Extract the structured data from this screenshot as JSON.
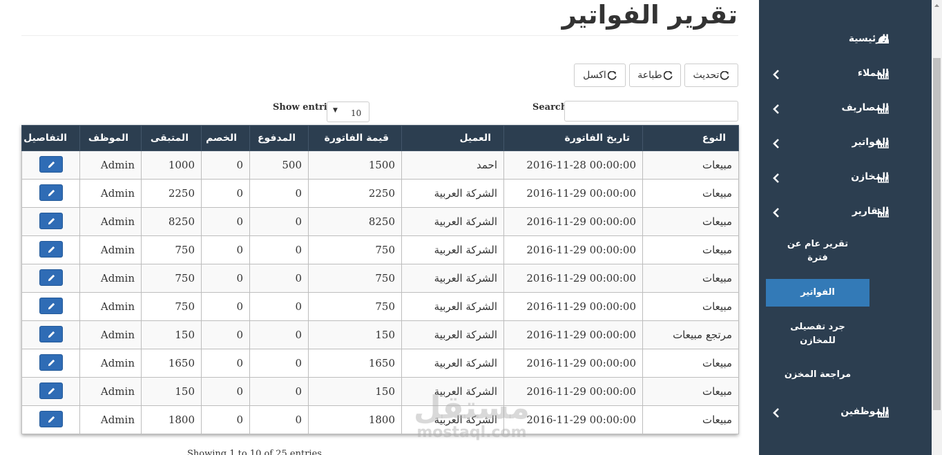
{
  "page": {
    "title": "تقرير الفواتير"
  },
  "toolbar": {
    "refresh_label": "تحديث",
    "print_label": "طباعة",
    "excel_label": "اكسل"
  },
  "controls": {
    "search_label": "Search:",
    "show_entries_label": "Show entries",
    "entries_value": "10"
  },
  "table": {
    "headers": [
      "النوع",
      "تاريخ الفاتورة",
      "العميل",
      "قيمة الفاتورة",
      "المدفوع",
      "الخصم",
      "المتبقى",
      "الموظف",
      "التفاصيل"
    ],
    "rows": [
      [
        "مبيعات",
        "2016-11-28 00:00:00",
        "احمد",
        "1500",
        "500",
        "0",
        "1000",
        "Admin"
      ],
      [
        "مبيعات",
        "2016-11-29 00:00:00",
        "الشركة العربية",
        "2250",
        "0",
        "0",
        "2250",
        "Admin"
      ],
      [
        "مبيعات",
        "2016-11-29 00:00:00",
        "الشركة العربية",
        "8250",
        "0",
        "0",
        "8250",
        "Admin"
      ],
      [
        "مبيعات",
        "2016-11-29 00:00:00",
        "الشركة العربية",
        "750",
        "0",
        "0",
        "750",
        "Admin"
      ],
      [
        "مبيعات",
        "2016-11-29 00:00:00",
        "الشركة العربية",
        "750",
        "0",
        "0",
        "750",
        "Admin"
      ],
      [
        "مبيعات",
        "2016-11-29 00:00:00",
        "الشركة العربية",
        "750",
        "0",
        "0",
        "750",
        "Admin"
      ],
      [
        "مرتجع مبيعات",
        "2016-11-29 00:00:00",
        "الشركة العربية",
        "150",
        "0",
        "0",
        "150",
        "Admin"
      ],
      [
        "مبيعات",
        "2016-11-29 00:00:00",
        "الشركة العربية",
        "1650",
        "0",
        "0",
        "1650",
        "Admin"
      ],
      [
        "مبيعات",
        "2016-11-29 00:00:00",
        "الشركة العربية",
        "150",
        "0",
        "0",
        "150",
        "Admin"
      ],
      [
        "مبيعات",
        "2016-11-29 00:00:00",
        "الشركة العربية",
        "1800",
        "0",
        "0",
        "1800",
        "Admin"
      ]
    ],
    "info": "Showing 1 to 10 of 25 entries"
  },
  "sidebar": {
    "home_label": "الرئيسية",
    "customers_label": "العملاء",
    "expenses_label": "المصاريف",
    "invoices_label": "الفواتير",
    "stores_label": "المخازن",
    "reports_label": "التقارير",
    "sub_period_report": "تقرير عام عن فترة",
    "sub_invoices": "الفواتير",
    "sub_inventory": "جرد تفصيلى للمخازن",
    "sub_store_review": "مراجعة المخزن",
    "employees_label": "الموظفين"
  },
  "watermark": {
    "arabic": "مستقل",
    "latin": "mostaql.com"
  },
  "colors": {
    "sidebar_bg": "#2c3e50",
    "active_item": "#337ab7",
    "edit_button": "#2f6cb5"
  }
}
